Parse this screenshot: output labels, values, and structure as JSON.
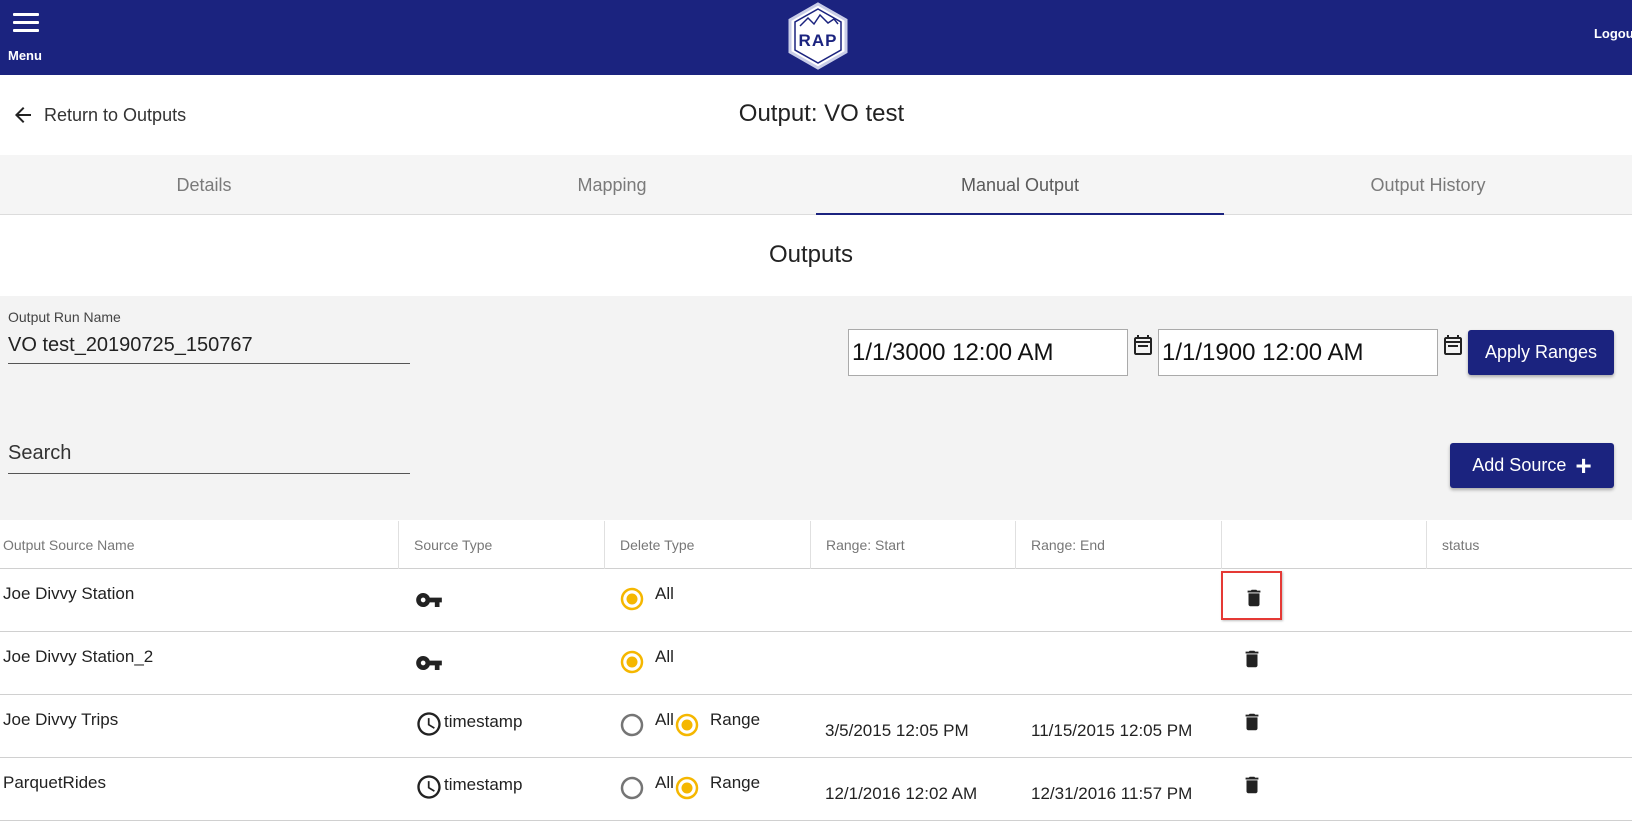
{
  "app": {
    "menu_label": "Menu",
    "logo_text": "RAP",
    "logout_label": "Logout"
  },
  "header": {
    "back_label": "Return to Outputs",
    "title": "Output: VO test"
  },
  "tabs": [
    {
      "label": "Details",
      "active": false
    },
    {
      "label": "Mapping",
      "active": false
    },
    {
      "label": "Manual Output",
      "active": true
    },
    {
      "label": "Output History",
      "active": false
    }
  ],
  "section_title": "Outputs",
  "form": {
    "run_name_label": "Output Run Name",
    "run_name_value": "VO test_20190725_150767",
    "range_start_value": "1/1/3000 12:00 AM",
    "range_end_value": "1/1/1900 12:00 AM",
    "apply_label": "Apply Ranges",
    "search_placeholder": "Search",
    "add_source_label": "Add Source",
    "add_source_icon": "+"
  },
  "table": {
    "columns": [
      "Output Source Name",
      "Source Type",
      "Delete Type",
      "Range: Start",
      "Range: End",
      "",
      "status"
    ],
    "rows": [
      {
        "name": "Joe Divvy Station",
        "type_icon": "key-icon",
        "type_label": "",
        "delete_all": "All",
        "delete_range": "",
        "selected": "all",
        "range_start": "",
        "range_end": "",
        "status": "",
        "highlighted": true
      },
      {
        "name": "Joe Divvy Station_2",
        "type_icon": "key-icon",
        "type_label": "",
        "delete_all": "All",
        "delete_range": "",
        "selected": "all",
        "range_start": "",
        "range_end": "",
        "status": "",
        "highlighted": false
      },
      {
        "name": "Joe Divvy Trips",
        "type_icon": "clock-icon",
        "type_label": "timestamp",
        "delete_all": "All",
        "delete_range": "Range",
        "selected": "range",
        "range_start": "3/5/2015 12:05 PM",
        "range_end": "11/15/2015 12:05 PM",
        "status": "",
        "highlighted": false
      },
      {
        "name": "ParquetRides",
        "type_icon": "clock-icon",
        "type_label": "timestamp",
        "delete_all": "All",
        "delete_range": "Range",
        "selected": "range",
        "range_start": "12/1/2016 12:02 AM",
        "range_end": "12/31/2016 11:57 PM",
        "status": "",
        "highlighted": false
      }
    ]
  },
  "colors": {
    "brand": "#1b237f",
    "radio_selected": "#f5b700",
    "highlight_border": "#e53935"
  }
}
